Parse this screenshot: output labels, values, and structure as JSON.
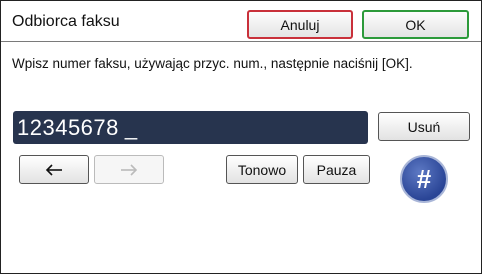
{
  "header": {
    "title": "Odbiorca faksu",
    "cancel_label": "Anuluj",
    "ok_label": "OK"
  },
  "instruction": "Wpisz numer faksu, używając przyc. num., następnie naciśnij [OK].",
  "fax_number": {
    "value": "12345678",
    "cursor": "_"
  },
  "buttons": {
    "delete_label": "Usuń",
    "tone_label": "Tonowo",
    "pause_label": "Pauza",
    "hash_label": "#"
  },
  "icons": {
    "left": "arrow-left-icon",
    "right": "arrow-right-icon"
  },
  "colors": {
    "cancel_border": "#c9303a",
    "ok_border": "#2c9a3a",
    "field_bg": "#27344e",
    "hash_bg": "#2a4596"
  }
}
